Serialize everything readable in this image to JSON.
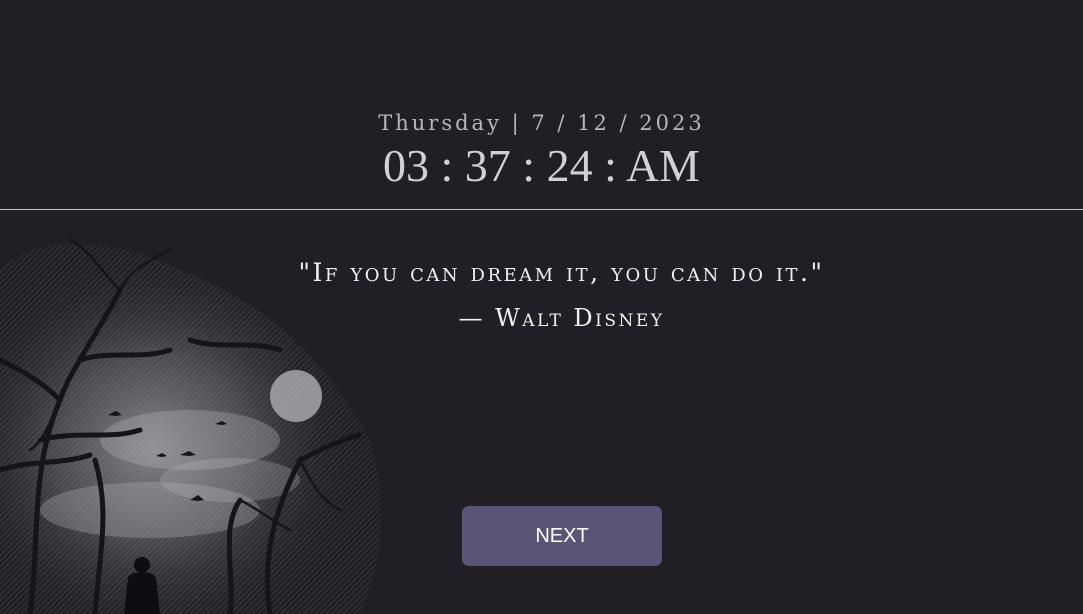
{
  "clock": {
    "date": "Thursday | 7 / 12 / 2023",
    "time": "03 : 37 : 24 : AM"
  },
  "quote": {
    "text": "\"If you can dream it, you can do it.\"",
    "author": "— Walt Disney"
  },
  "controls": {
    "next_label": "NEXT"
  },
  "background": {
    "image_description_icon": "forest-night-scene-icon",
    "accent_color": "#5a5475",
    "page_color": "#221e26"
  }
}
